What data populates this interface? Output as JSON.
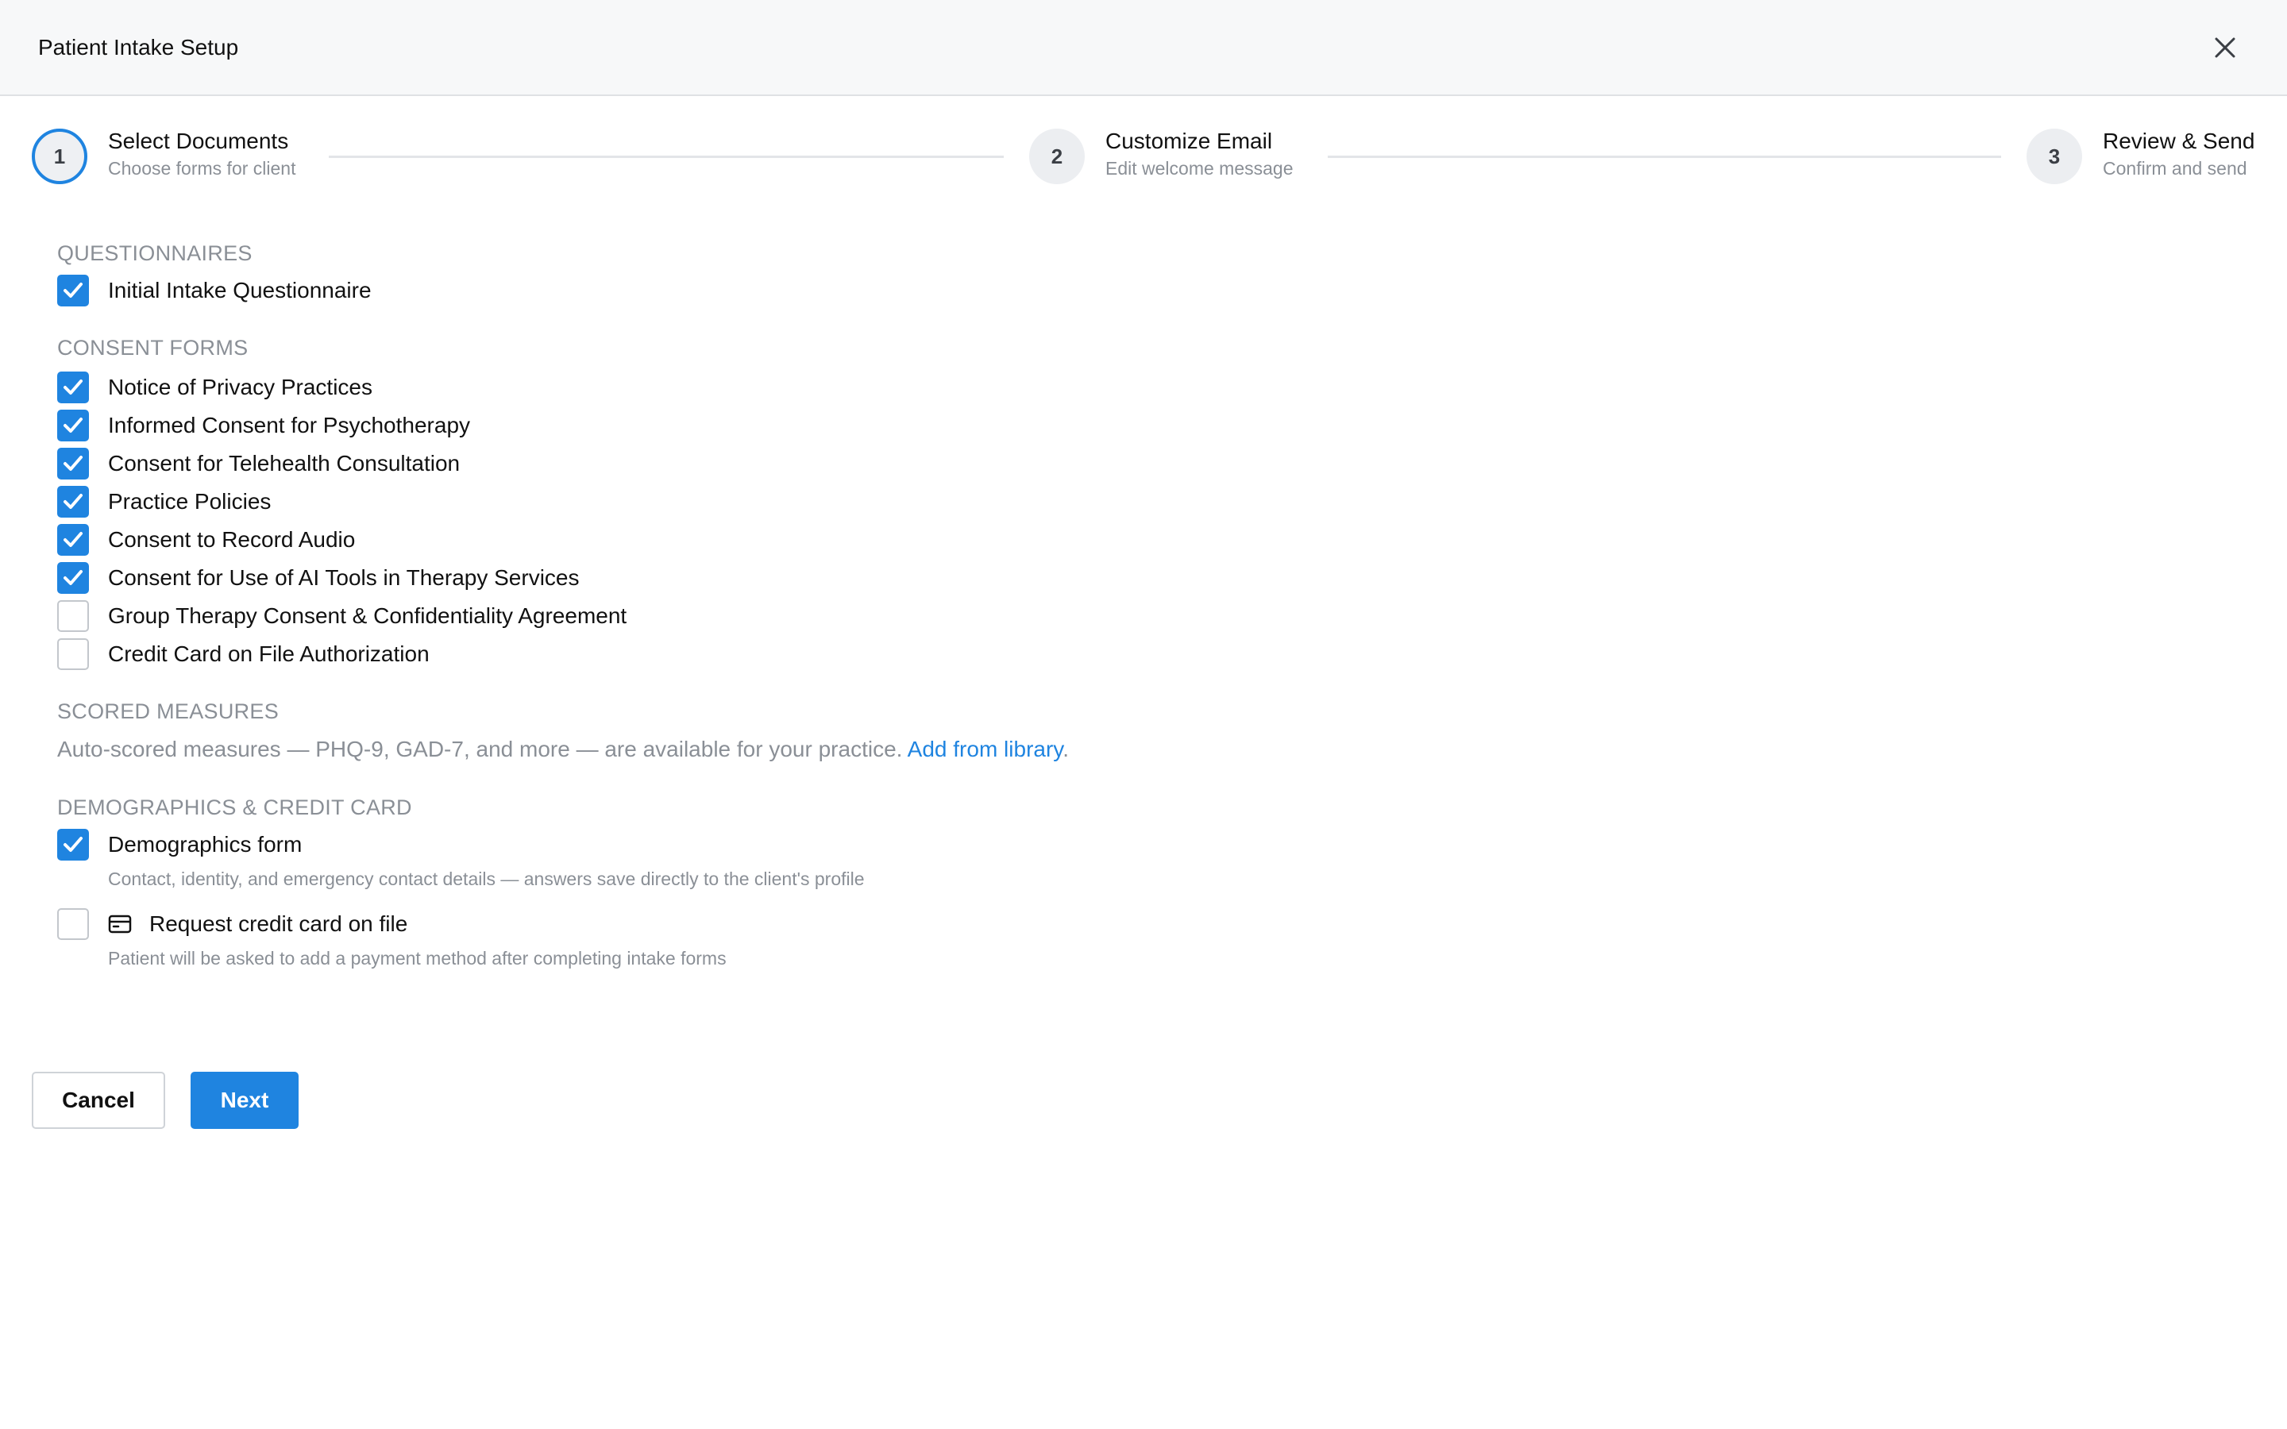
{
  "dialog": {
    "title": "Patient Intake Setup",
    "close_icon": "close-icon"
  },
  "stepper": {
    "current_step": 1,
    "steps": [
      {
        "number": "1",
        "title": "Select Documents",
        "subtitle": "Choose forms for client"
      },
      {
        "number": "2",
        "title": "Customize Email",
        "subtitle": "Edit welcome message"
      },
      {
        "number": "3",
        "title": "Review & Send",
        "subtitle": "Confirm and send"
      }
    ]
  },
  "questionnaires": {
    "heading": "QUESTIONNAIRES",
    "items": [
      {
        "label": "Initial Intake Questionnaire",
        "checked": true
      }
    ]
  },
  "consent_forms": {
    "heading": "CONSENT FORMS",
    "items": [
      {
        "label": "Notice of Privacy Practices",
        "checked": true
      },
      {
        "label": "Informed Consent for Psychotherapy",
        "checked": true
      },
      {
        "label": "Consent for Telehealth Consultation",
        "checked": true
      },
      {
        "label": "Practice Policies",
        "checked": true
      },
      {
        "label": "Consent to Record Audio",
        "checked": true
      },
      {
        "label": "Consent for Use of AI Tools in Therapy Services",
        "checked": true
      },
      {
        "label": "Group Therapy Consent & Confidentiality Agreement",
        "checked": false
      },
      {
        "label": "Credit Card on File Authorization",
        "checked": false
      }
    ]
  },
  "scored_measures": {
    "heading": "SCORED MEASURES",
    "text": "Auto-scored measures — PHQ-9, GAD-7, and more — are available for your practice. ",
    "link": "Add from library",
    "after_link": "."
  },
  "demographics": {
    "heading": "DEMOGRAPHICS & CREDIT CARD",
    "demographics_form": {
      "label": "Demographics form",
      "checked": true,
      "description": "Contact, identity, and emergency contact details — answers save directly to the client's profile"
    },
    "credit_card": {
      "label": "Request credit card on file",
      "checked": false,
      "icon": "credit-card-icon",
      "description": "Patient will be asked to add a payment method after completing intake forms"
    }
  },
  "footer": {
    "cancel_label": "Cancel",
    "next_label": "Next"
  },
  "colors": {
    "accent": "#1f84e0",
    "muted_text": "#8a8f96",
    "header_bg": "#f7f8f9"
  }
}
